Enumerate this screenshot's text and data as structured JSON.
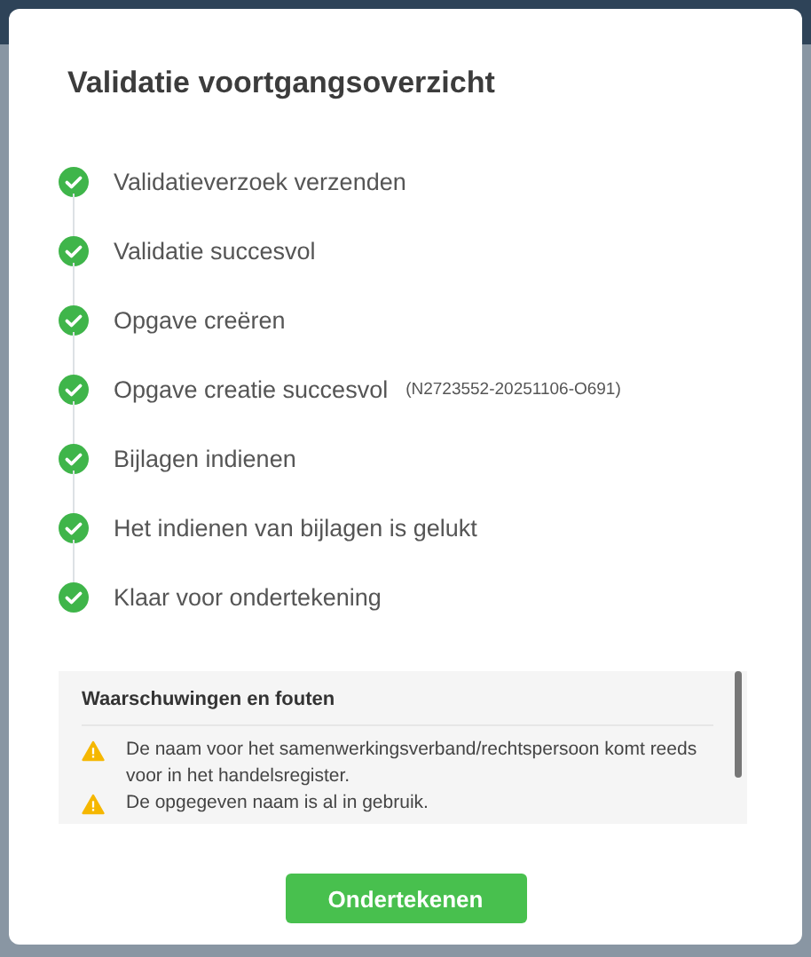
{
  "dialog": {
    "title": "Validatie voortgangsoverzicht"
  },
  "steps": [
    {
      "label": "Validatieverzoek verzenden",
      "done": true
    },
    {
      "label": "Validatie succesvol",
      "done": true
    },
    {
      "label": "Opgave creëren",
      "done": true
    },
    {
      "label": "Opgave creatie succesvol",
      "detail": "(N2723552-20251106-O691)",
      "done": true
    },
    {
      "label": "Bijlagen indienen",
      "done": true
    },
    {
      "label": "Het indienen van bijlagen is gelukt",
      "done": true
    },
    {
      "label": "Klaar voor ondertekening",
      "done": true
    }
  ],
  "messages_panel": {
    "title": "Waarschuwingen en fouten",
    "messages": [
      {
        "kind": "warning",
        "text": "De naam voor het samenwerkingsverband/rechtspersoon komt reeds voor in het handelsregister."
      },
      {
        "kind": "warning",
        "text": "De opgegeven naam is al in gebruik."
      }
    ]
  },
  "primary_button": "Ondertekenen"
}
